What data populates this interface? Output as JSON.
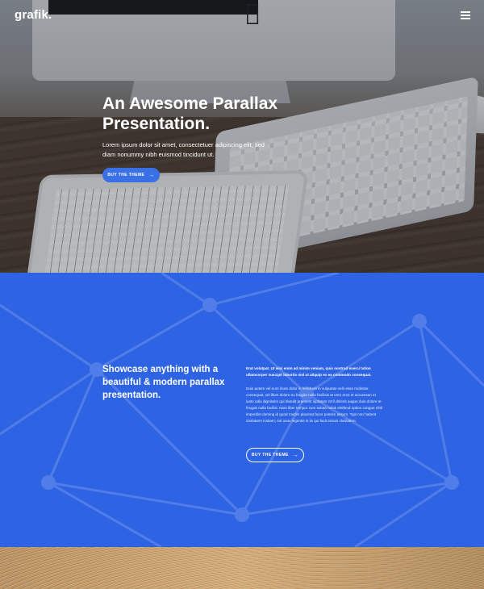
{
  "header": {
    "logo": "grafik.",
    "menu_icon": "hamburger-menu-icon"
  },
  "hero": {
    "title": "An Awesome Parallax Presentation.",
    "text": "Lorem ipsum dolor sit amet, consectetuer adipiscing elit, sed diam nonummy nibh euismod tincidunt ut.",
    "button_label": "Buy the theme",
    "button_icon": "arrow-right-icon",
    "button_arrow": "→"
  },
  "showcase": {
    "title": "Showcase anything with a beautiful & modern parallax presentation.",
    "lead": "Erat volutpat. Ut wisi enim ad minim veniam, quis nostrud exerci tation ullamcorper suscipit lobortis nisl ut aliquip ex ea commodo consequat.",
    "body": "Duis autem vel eum iriure dolor in hendrerit in vulputate velit esse molestie consequat, vel illum dolore eu feugiat nulla facilisis at vero eros et accumsan et iusto odio dignissim qui blandit praesent luptatum zzril delenit augue duis dolore te feugait nulla facilisi. Nam liber tempor cum soluta nobis eleifend option congue nihil imperdiet doming id quod mazim placerat facer possim assum. Typi non habent claritatem insitam; est usus legentis in iis qui facit eorum claritatem.",
    "button_label": "Buy the theme",
    "button_arrow": "→"
  },
  "colors": {
    "accent_blue": "#2e64e3",
    "button_blue": "#3a70e6",
    "white": "#ffffff"
  }
}
